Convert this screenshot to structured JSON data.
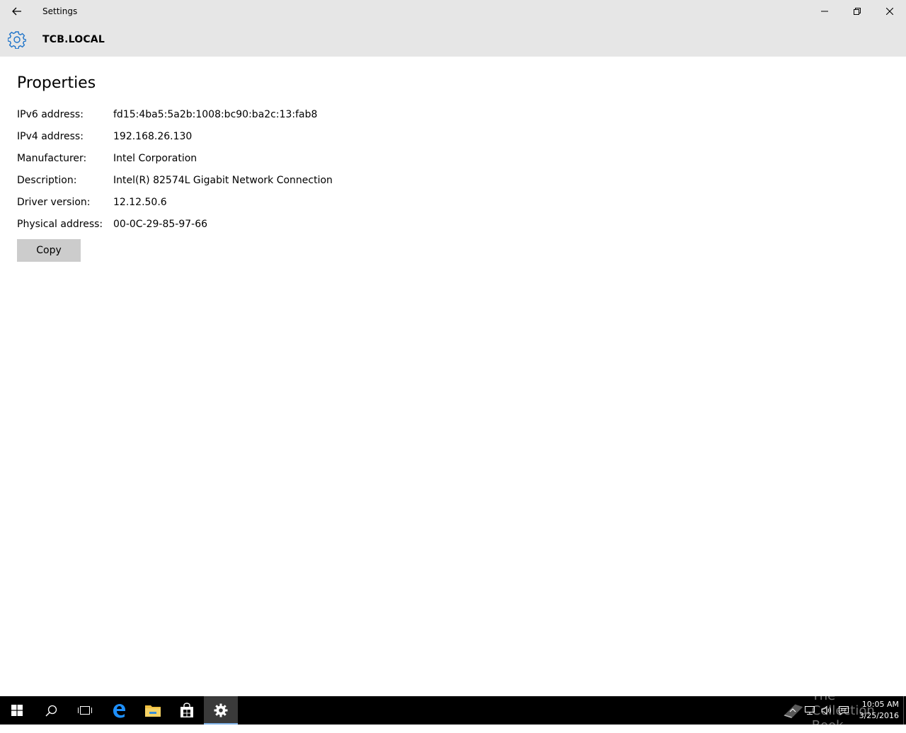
{
  "window": {
    "title": "Settings",
    "header_title": "TCB.LOCAL"
  },
  "icons": {
    "back": "back-arrow-icon",
    "minimize": "minimize-icon",
    "restore": "restore-icon",
    "close": "close-icon",
    "header": "gear-icon"
  },
  "properties": {
    "title": "Properties",
    "rows": [
      {
        "label": "IPv6 address:",
        "value": "fd15:4ba5:5a2b:1008:bc90:ba2c:13:fab8"
      },
      {
        "label": "IPv4 address:",
        "value": "192.168.26.130"
      },
      {
        "label": "Manufacturer:",
        "value": "Intel Corporation"
      },
      {
        "label": "Description:",
        "value": "Intel(R) 82574L Gigabit Network Connection"
      },
      {
        "label": "Driver version:",
        "value": "12.12.50.6"
      },
      {
        "label": "Physical address:",
        "value": "00-0C-29-85-97-66"
      }
    ],
    "copy_label": "Copy"
  },
  "taskbar": {
    "items": [
      "start",
      "search",
      "task-view",
      "edge",
      "file-explorer",
      "store",
      "settings"
    ],
    "active": "settings",
    "watermark": "The Collection Book",
    "clock_time": "10:05 AM",
    "clock_date": "3/25/2016"
  },
  "colors": {
    "titlebar_bg": "#e6e6e6",
    "accent": "#1e73c9",
    "button_bg": "#cccccc",
    "taskbar_bg": "#000000"
  }
}
